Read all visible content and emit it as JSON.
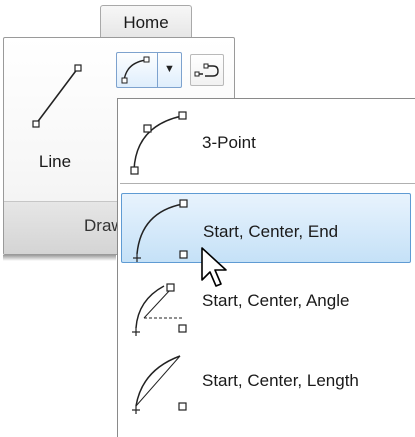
{
  "ribbon": {
    "tab_label": "Home",
    "panel_label": "Draw",
    "line_button_label": "Line"
  },
  "icons": {
    "tab": "home-tab",
    "line": "line-icon",
    "arc": "arc-icon",
    "dropdown": "chevron-down-icon",
    "polyline": "polyline-icon",
    "cursor": "mouse-pointer-icon"
  },
  "arc_menu": {
    "items": [
      {
        "label": "3-Point",
        "icon": "arc-3point-icon"
      },
      {
        "label": "Start, Center, End",
        "icon": "arc-start-center-end-icon",
        "highlighted": true
      },
      {
        "label": "Start, Center, Angle",
        "icon": "arc-start-center-angle-icon"
      },
      {
        "label": "Start, Center, Length",
        "icon": "arc-start-center-length-icon"
      }
    ]
  },
  "colors": {
    "highlight_fill": "#c5e1f7",
    "highlight_border": "#5f9bd3"
  }
}
